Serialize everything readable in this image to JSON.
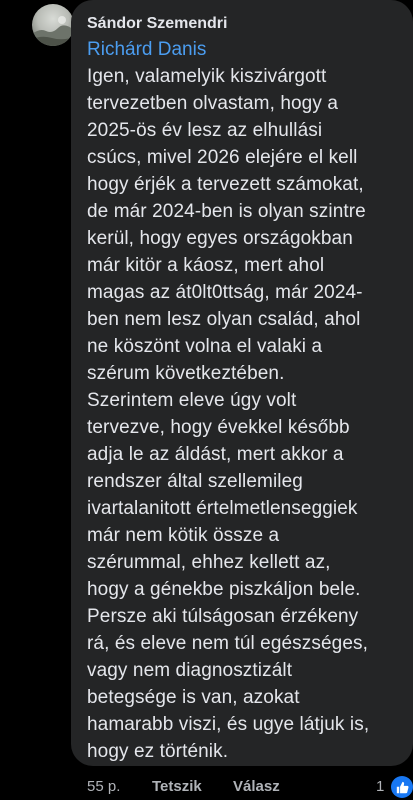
{
  "comment": {
    "author": "Sándor Szemendri",
    "mention": "Richárd Danis",
    "body": "Igen, valamelyik kiszivárgott\ntervezetben olvastam, hogy a\n2025-ös év lesz az elhullási\ncsúcs, mivel 2026 elejére el kell\nhogy érjék a tervezett számokat,\nde már 2024-ben is olyan szintre\nkerül, hogy egyes országokban\nmár kitör a káosz, mert ahol\nmagas az át0lt0ttság, már 2024-\nben nem lesz olyan család, ahol\nne köszönt volna el valaki a\nszérum következtében.\nSzerintem eleve úgy volt\ntervezve, hogy évekkel később\nadja le az áldást, mert akkor a\nrendszer által szellemileg\nivartalanitott értelmetlenseggiek\nmár nem kötik össze a\nszérummal, ehhez kellett az,\nhogy a génekbe piszkáljon bele.\nPersze aki túlságosan érzékeny\nrá, és eleve nem túl egészséges,\nvagy nem diagnosztizált\nbetegsége is van, azokat\nhamarabb viszi, és ugye látjuk is,\nhogy ez történik."
  },
  "footer": {
    "time": "55 p.",
    "like_label": "Tetszik",
    "reply_label": "Válasz",
    "reaction_count": "1"
  },
  "colors": {
    "background": "#000000",
    "bubble": "#242526",
    "mention": "#4b9df0",
    "like_icon": "#1877f2"
  },
  "icons": {
    "reaction": "thumbs-up-icon"
  }
}
